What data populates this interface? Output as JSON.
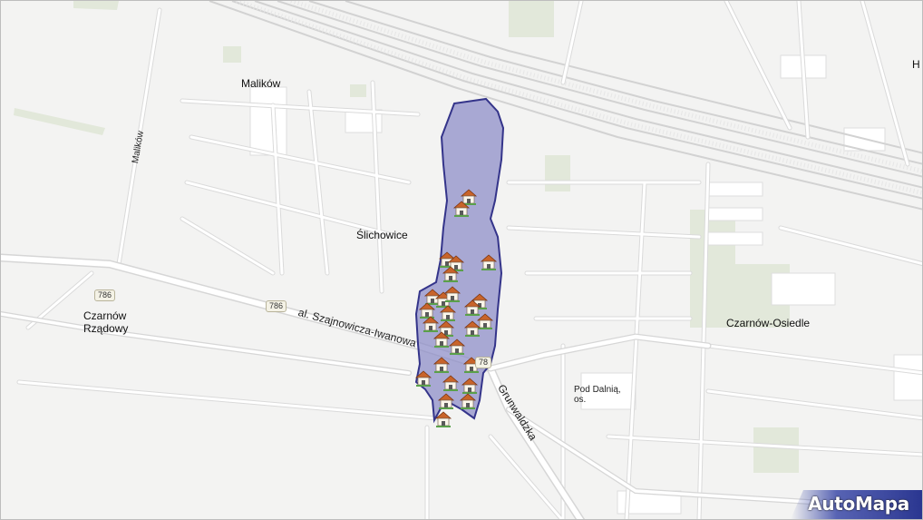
{
  "places": {
    "malikow": "Malików",
    "slichowice": "Ślichowice",
    "czarnow_rzadowy_1": "Czarnów",
    "czarnow_rzadowy_2": "Rządowy",
    "czarnow_osiedle": "Czarnów-Osiedle",
    "pod_dalnia_1": "Pod Dalnią,",
    "pod_dalnia_2": "os.",
    "edge_top_right": "H"
  },
  "roads": {
    "malikow_street": "Malików",
    "szajnowicza": "al. Szajnowicza-Iwanowa",
    "grunwaldzka": "Grunwaldzka"
  },
  "shields": {
    "s1": "786",
    "s2": "786",
    "s3": "78"
  },
  "brand": {
    "logo": "AutoMapa"
  },
  "colors": {
    "background": "#f3f3f2",
    "road": "#ffffff",
    "road_casing": "#dcdcdc",
    "rail": "#cfcfcf",
    "green": "#dfe6d6",
    "polygon_fill": "#8a8ac6",
    "polygon_stroke": "#34348a",
    "marker_roof": "#c8642a"
  },
  "icons": {
    "marker": "house-marker-icon"
  }
}
